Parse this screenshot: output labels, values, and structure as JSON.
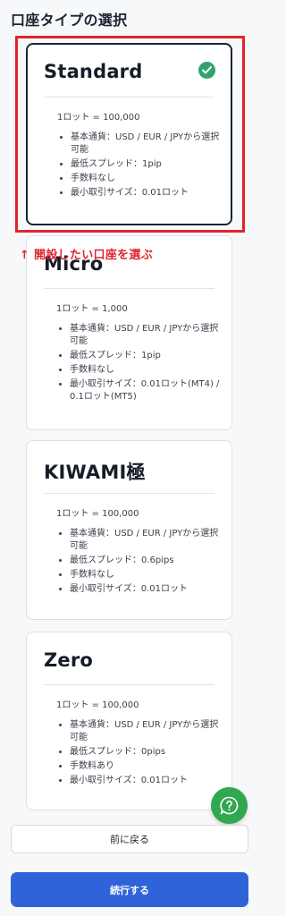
{
  "page": {
    "title": "口座タイプの選択"
  },
  "annotation": {
    "text": "↑ 開設したい口座を選ぶ"
  },
  "accounts": [
    {
      "name": "Standard",
      "selected": true,
      "lot": "1ロット = 100,000",
      "features": [
        "基本通貨：USD / EUR / JPYから選択可能",
        "最低スプレッド：1pip",
        "手数料なし",
        "最小取引サイズ：0.01ロット"
      ]
    },
    {
      "name": "Micro",
      "selected": false,
      "lot": "1ロット = 1,000",
      "features": [
        "基本通貨：USD / EUR / JPYから選択可能",
        "最低スプレッド：1pip",
        "手数料なし",
        "最小取引サイズ：0.01ロット(MT4) / 0.1ロット(MT5)"
      ]
    },
    {
      "name": "KIWAMI極",
      "selected": false,
      "lot": "1ロット = 100,000",
      "features": [
        "基本通貨：USD / EUR / JPYから選択可能",
        "最低スプレッド：0.6pips",
        "手数料なし",
        "最小取引サイズ：0.01ロット"
      ]
    },
    {
      "name": "Zero",
      "selected": false,
      "lot": "1ロット = 100,000",
      "features": [
        "基本通貨：USD / EUR / JPYから選択可能",
        "最低スプレッド：0pips",
        "手数料あり",
        "最小取引サイズ：0.01ロット"
      ]
    }
  ],
  "buttons": {
    "back": "前に戻る",
    "continue": "続行する"
  },
  "icons": {
    "selected": "check-circle-icon",
    "help": "help-chat-icon"
  },
  "colors": {
    "highlight": "#e0262d",
    "check": "#2fa36c",
    "primary": "#2f64d9",
    "help": "#2fa84f"
  }
}
